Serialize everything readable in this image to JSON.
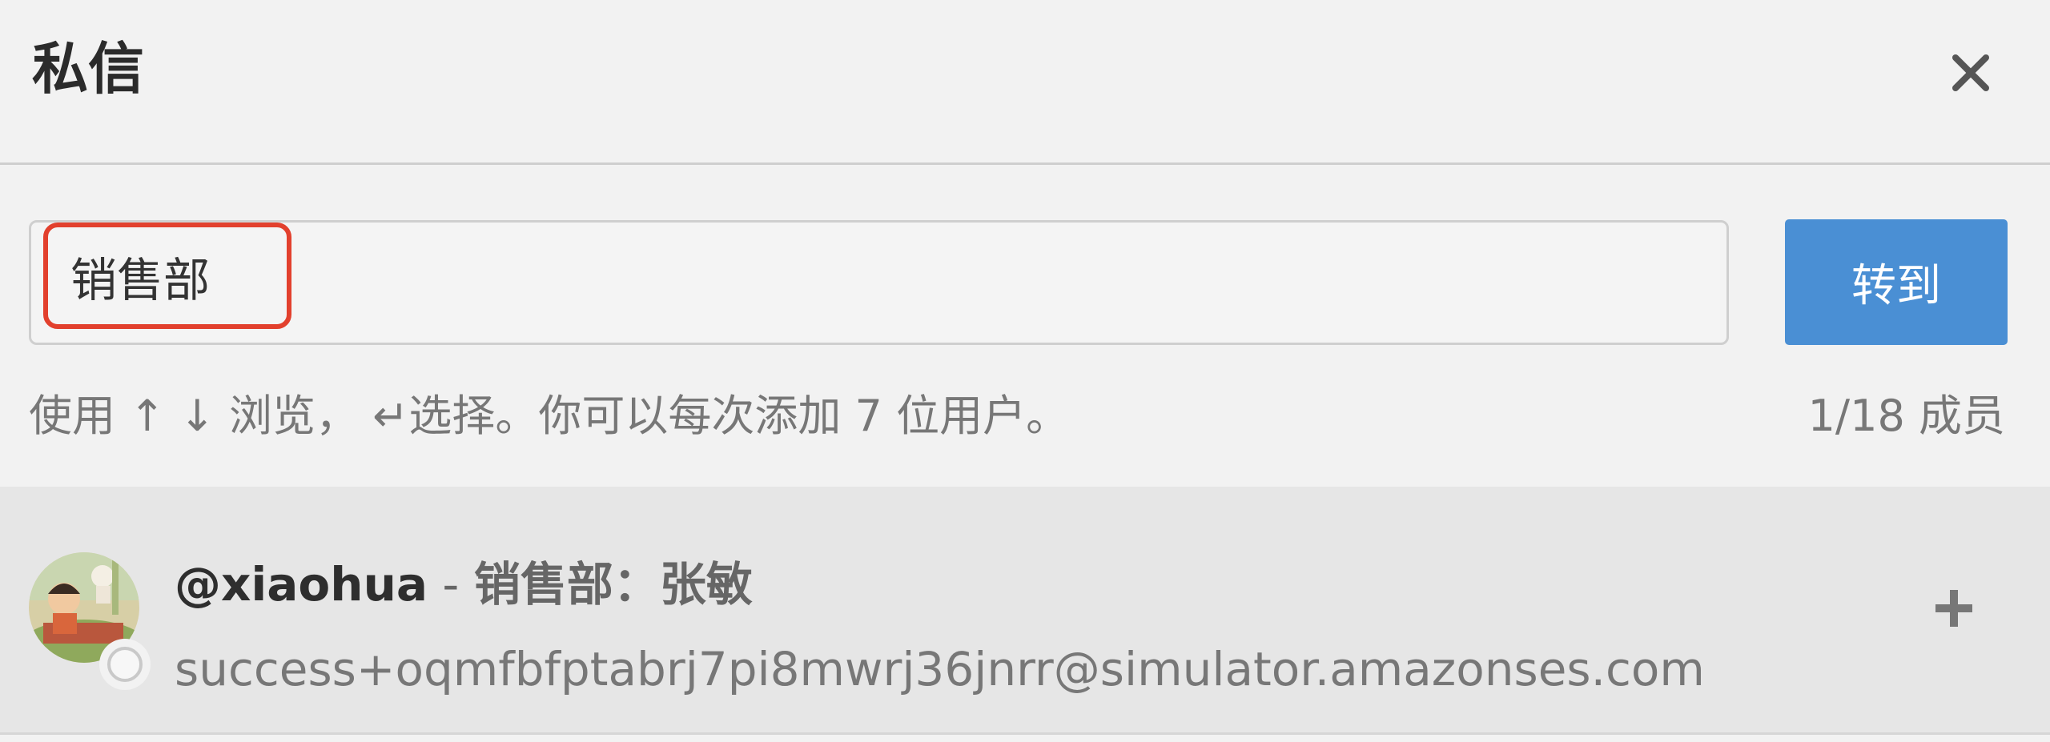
{
  "dialog": {
    "title": "私信",
    "close_icon": "close-icon"
  },
  "search": {
    "selected_chip": "销售部",
    "go_button_label": "转到"
  },
  "hint": {
    "text": "使用 ↑ ↓ 浏览， ↵选择。你可以每次添加 7 位用户。",
    "count": "1/18 成员"
  },
  "results": [
    {
      "username": "@xiaohua",
      "separator": " - ",
      "display_name": "销售部：张敏",
      "email": "success+oqmfbfptabrj7pi8mwrj36jnrr@simulator.amazonses.com",
      "status": "offline",
      "add_icon": "plus-icon"
    }
  ],
  "colors": {
    "accent": "#4a8fd4",
    "highlight_border": "#e2402d",
    "row_background": "#e6e6e6"
  }
}
